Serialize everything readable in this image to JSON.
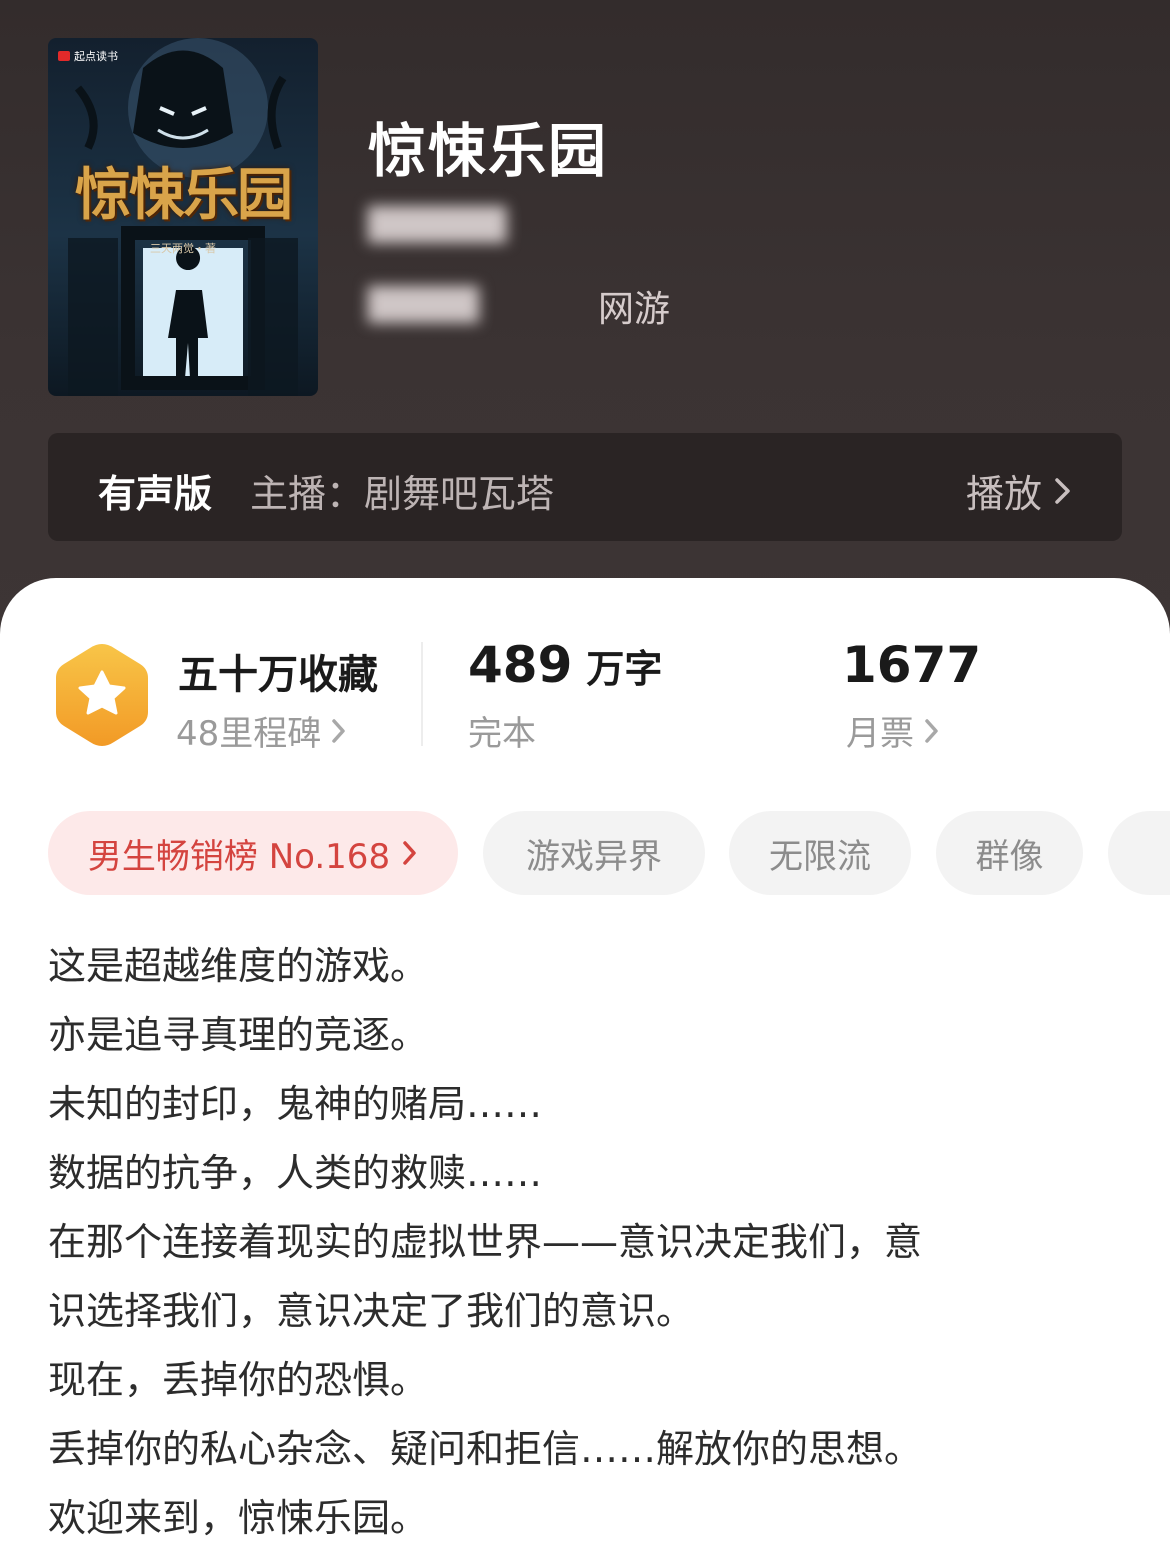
{
  "header": {
    "cover": {
      "brand": "起点读书",
      "title": "惊悚乐园",
      "author": "三天两觉・著"
    },
    "book_title": "惊悚乐园",
    "genre_tail": "网游"
  },
  "audio": {
    "label": "有声版",
    "host": "主播：剧舞吧瓦塔",
    "play": "播放"
  },
  "stats": {
    "collect_main": "五十万收藏",
    "milestones": "48里程碑",
    "words_num": "489",
    "words_unit": "万字",
    "status": "完本",
    "votes_num": "1677",
    "votes_label": "月票"
  },
  "tags": {
    "rank": "男生畅销榜 No.168",
    "items": [
      "游戏异界",
      "无限流",
      "群像"
    ]
  },
  "description": [
    "这是超越维度的游戏。",
    "亦是追寻真理的竞逐。",
    "未知的封印，鬼神的赌局……",
    "数据的抗争，人类的救赎……",
    "在那个连接着现实的虚拟世界——意识决定我们，意",
    "识选择我们，意识决定了我们的意识。",
    "现在，丢掉你的恐惧。",
    "丢掉你的私心杂念、疑问和拒信……解放你的思想。",
    "欢迎来到，惊悚乐园。"
  ],
  "colors": {
    "header_bg": "#3a3232",
    "rank_tag_bg": "#fde9e9",
    "rank_tag_text": "#d4443f",
    "badge": "#f5a623"
  }
}
